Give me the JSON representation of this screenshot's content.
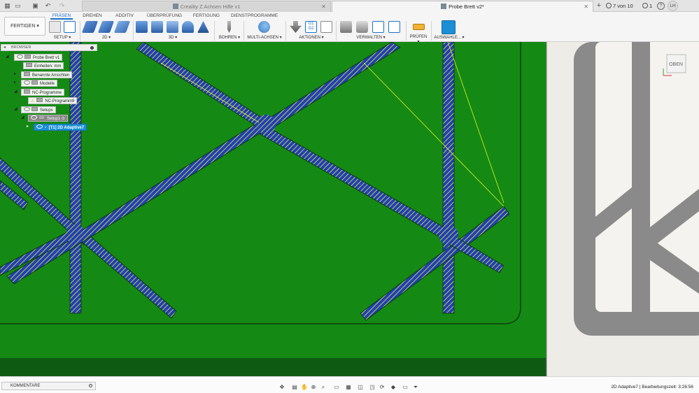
{
  "titlebar": {
    "tabs": [
      {
        "label": "Creality Z Achsen Hilfe v1",
        "active": false
      },
      {
        "label": "Probe Brett v2*",
        "active": true
      }
    ],
    "jobs_label": "7 von 10",
    "notifications": "1",
    "user_initials": "LH"
  },
  "ribbon": {
    "workspace": "FERTIGEN",
    "tabs": [
      "FRÄSEN",
      "DREHEN",
      "ADDITIV",
      "ÜBERPRÜFUNG",
      "FERTIGUNG",
      "DIENSTPROGRAMME"
    ],
    "groups": [
      "SETUP ▾",
      "2D ▾",
      "3D ▾",
      "BOHREN ▾",
      "MULTI-ACHSEN ▾",
      "AKTIONEN ▾",
      "VERWALTEN ▾",
      "PRÜFEN ▾",
      "AUSWAHLE... ▾"
    ],
    "accent_color": "#1a73c9"
  },
  "browser": {
    "title": "BROWSER",
    "items": [
      "Probe Brett v1",
      "Einheiten: mm",
      "Benannte Ansichten",
      "Modelle",
      "NC-Programme",
      "NC-Programm9",
      "Setups",
      "Setup1",
      "[T1] 2D Adaptive7"
    ]
  },
  "viewcube": {
    "label": "OBEN"
  },
  "statusbar": {
    "comments": "KOMMENTARE",
    "right_text": "2D Adaptive7 | Bearbeitungszeit: 3:26:56"
  },
  "colors": {
    "stock": "#148a14",
    "toolpath_blue": "#1f3fb8",
    "toolpath_yellow": "#e6f026",
    "part_grey": "#8a8a8a"
  }
}
